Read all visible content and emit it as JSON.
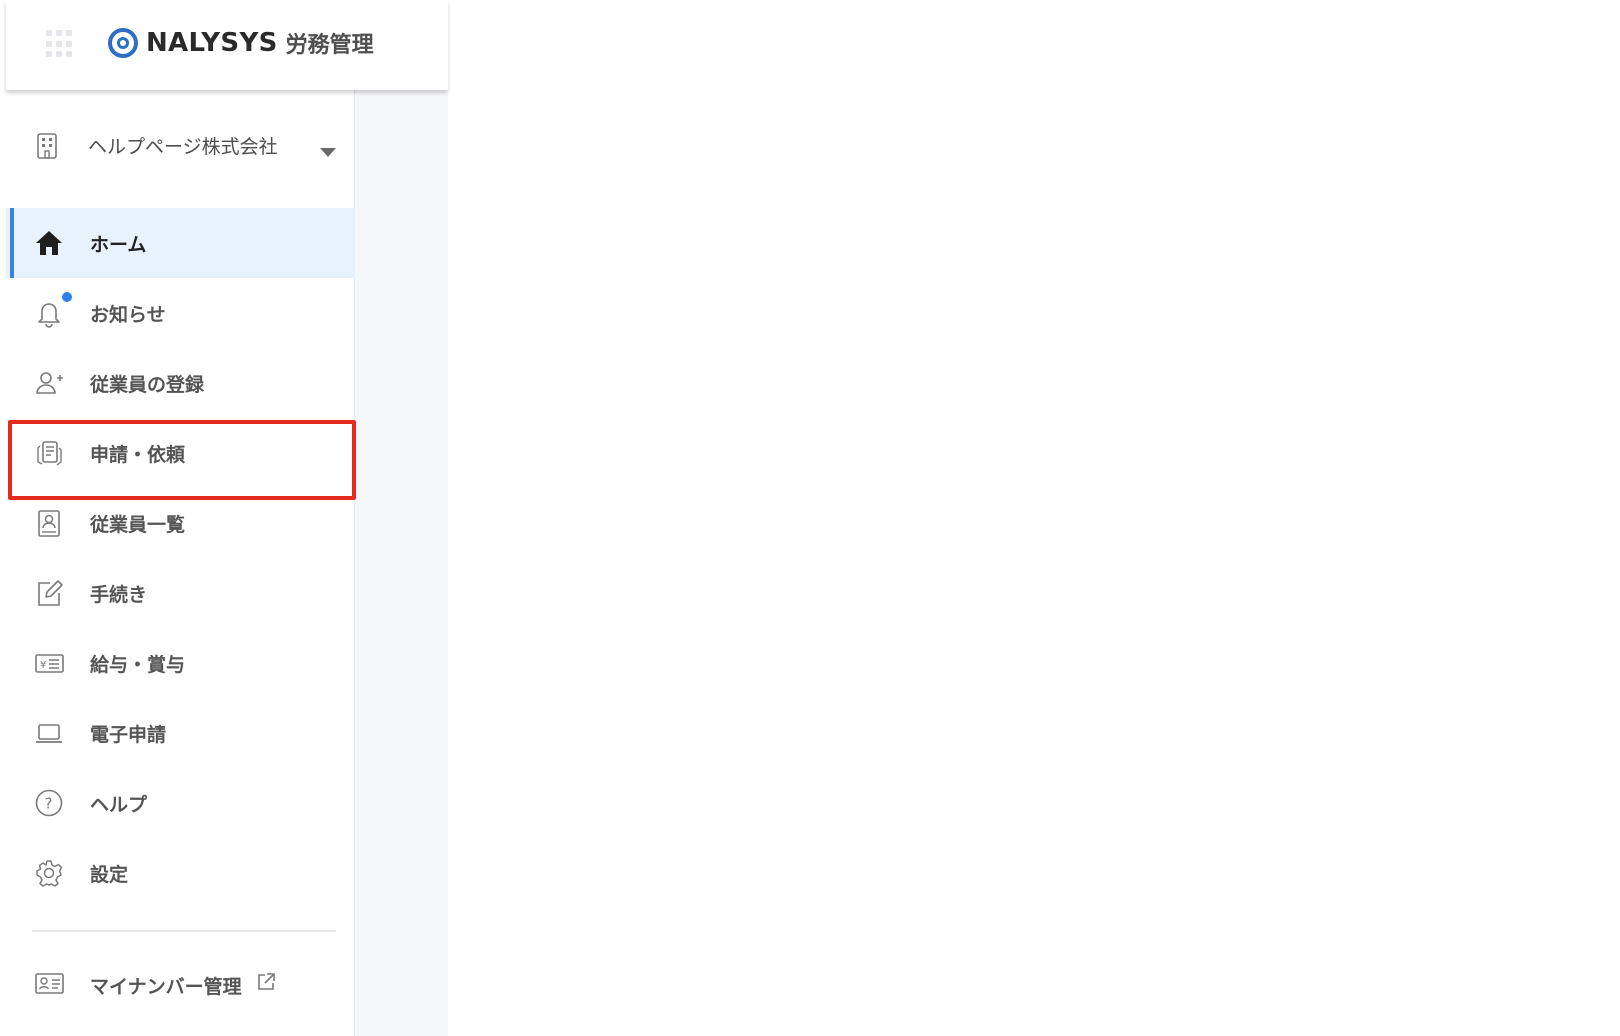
{
  "header": {
    "brand": "NALYSYS",
    "product": "労務管理"
  },
  "company": {
    "name": "ヘルプページ株式会社"
  },
  "nav": {
    "items": [
      {
        "label": "ホーム",
        "icon": "home-icon",
        "active": true
      },
      {
        "label": "お知らせ",
        "icon": "bell-icon",
        "badge": true
      },
      {
        "label": "従業員の登録",
        "icon": "person-add-icon"
      },
      {
        "label": "申請・依頼",
        "icon": "documents-icon",
        "highlighted": true
      },
      {
        "label": "従業員一覧",
        "icon": "employee-list-icon"
      },
      {
        "label": "手続き",
        "icon": "edit-icon"
      },
      {
        "label": "給与・賞与",
        "icon": "yen-icon"
      },
      {
        "label": "電子申請",
        "icon": "laptop-icon"
      },
      {
        "label": "ヘルプ",
        "icon": "help-icon"
      },
      {
        "label": "設定",
        "icon": "gear-icon"
      }
    ],
    "footer": {
      "label": "マイナンバー管理",
      "icon": "id-card-icon",
      "external_icon": "external-link-icon"
    }
  },
  "colors": {
    "accent": "#3b82e0",
    "active_bg": "#e8f2fd",
    "highlight": "#e32b20",
    "brand": "#2d6fc5"
  }
}
